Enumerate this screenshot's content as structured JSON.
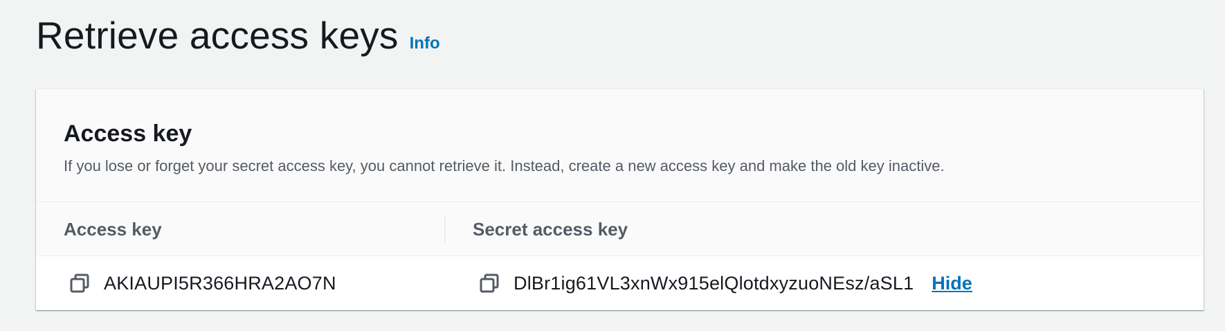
{
  "header": {
    "title": "Retrieve access keys",
    "info_label": "Info"
  },
  "card": {
    "title": "Access key",
    "description": "If you lose or forget your secret access key, you cannot retrieve it. Instead, create a new access key and make the old key inactive.",
    "columns": [
      "Access key",
      "Secret access key"
    ],
    "row": {
      "access_key": "AKIAUPI5R366HRA2AO7N",
      "secret_access_key": "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",
      "hide_label": "Hide"
    },
    "icons": {
      "copy": "copy-icon"
    }
  },
  "colors": {
    "link": "#0073bb",
    "background": "#f2f3f3",
    "text": "#16191f",
    "muted_text": "#545b64"
  }
}
